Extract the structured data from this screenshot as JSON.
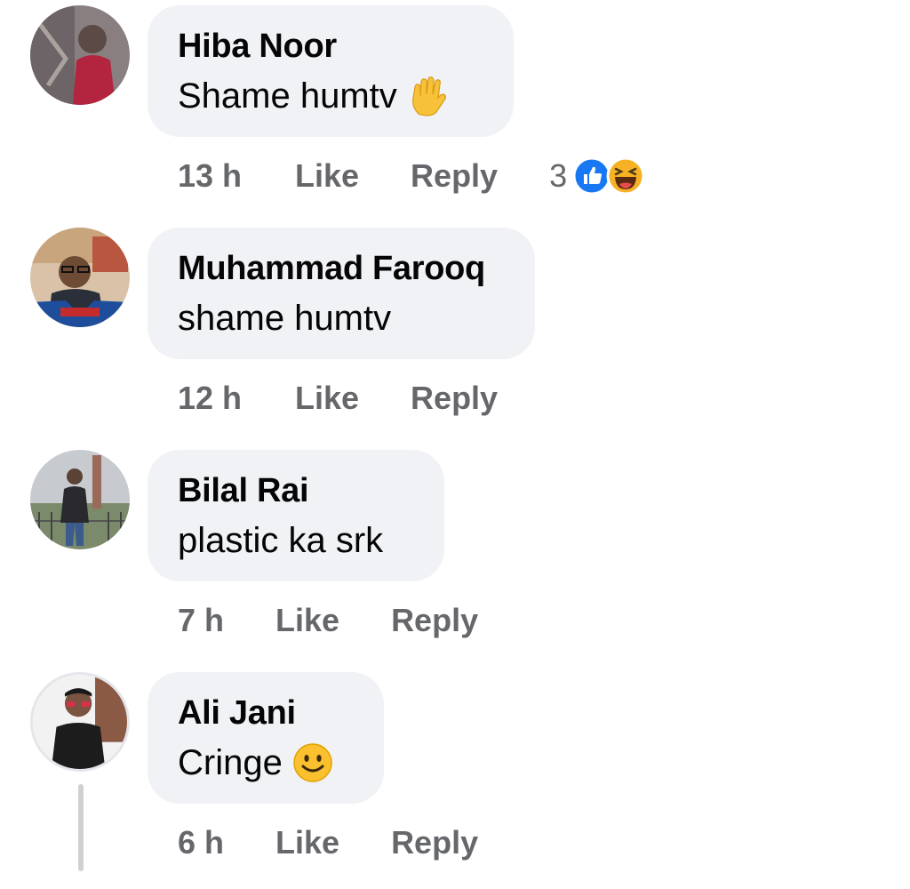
{
  "comments": [
    {
      "author": "Hiba Noor",
      "text": "Shame humtv",
      "emoji": "raised-hand-emoji",
      "time": "13 h",
      "like_label": "Like",
      "reply_label": "Reply",
      "reactions": {
        "count": "3",
        "types": [
          "like-reaction-icon",
          "haha-reaction-icon"
        ]
      }
    },
    {
      "author": "Muhammad Farooq",
      "text": "shame humtv",
      "time": "12 h",
      "like_label": "Like",
      "reply_label": "Reply"
    },
    {
      "author": "Bilal Rai",
      "text": "plastic ka srk",
      "time": "7 h",
      "like_label": "Like",
      "reply_label": "Reply"
    },
    {
      "author": "Ali Jani",
      "text": "Cringe",
      "emoji": "smiling-face-emoji",
      "time": "6 h",
      "like_label": "Like",
      "reply_label": "Reply"
    }
  ],
  "colors": {
    "bubble": "#f0f2f5",
    "meta_text": "#65676b",
    "like_blue": "#1877f2",
    "haha_yellow": "#f7b125"
  }
}
